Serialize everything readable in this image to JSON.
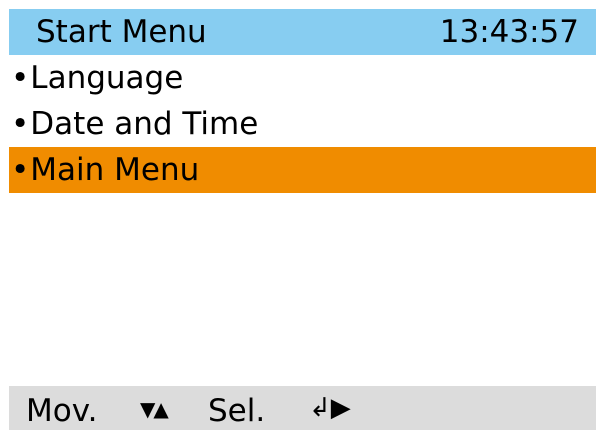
{
  "header": {
    "title": "Start Menu",
    "time": "13:43:57",
    "background_color": "#87cdf1"
  },
  "menu": {
    "bullet": "•",
    "items": [
      {
        "label": "Language",
        "selected": false
      },
      {
        "label": "Date and Time",
        "selected": false
      },
      {
        "label": "Main Menu",
        "selected": true
      }
    ],
    "selected_color": "#f08c00"
  },
  "footer": {
    "move_label": "Mov.",
    "move_icon": "▼▲",
    "move_icon_name": "up-down-arrows-icon",
    "select_label": "Sel.",
    "select_icon": "↲▶",
    "select_icon_name": "enter-arrow-icon",
    "background_color": "#dcdcdc"
  }
}
